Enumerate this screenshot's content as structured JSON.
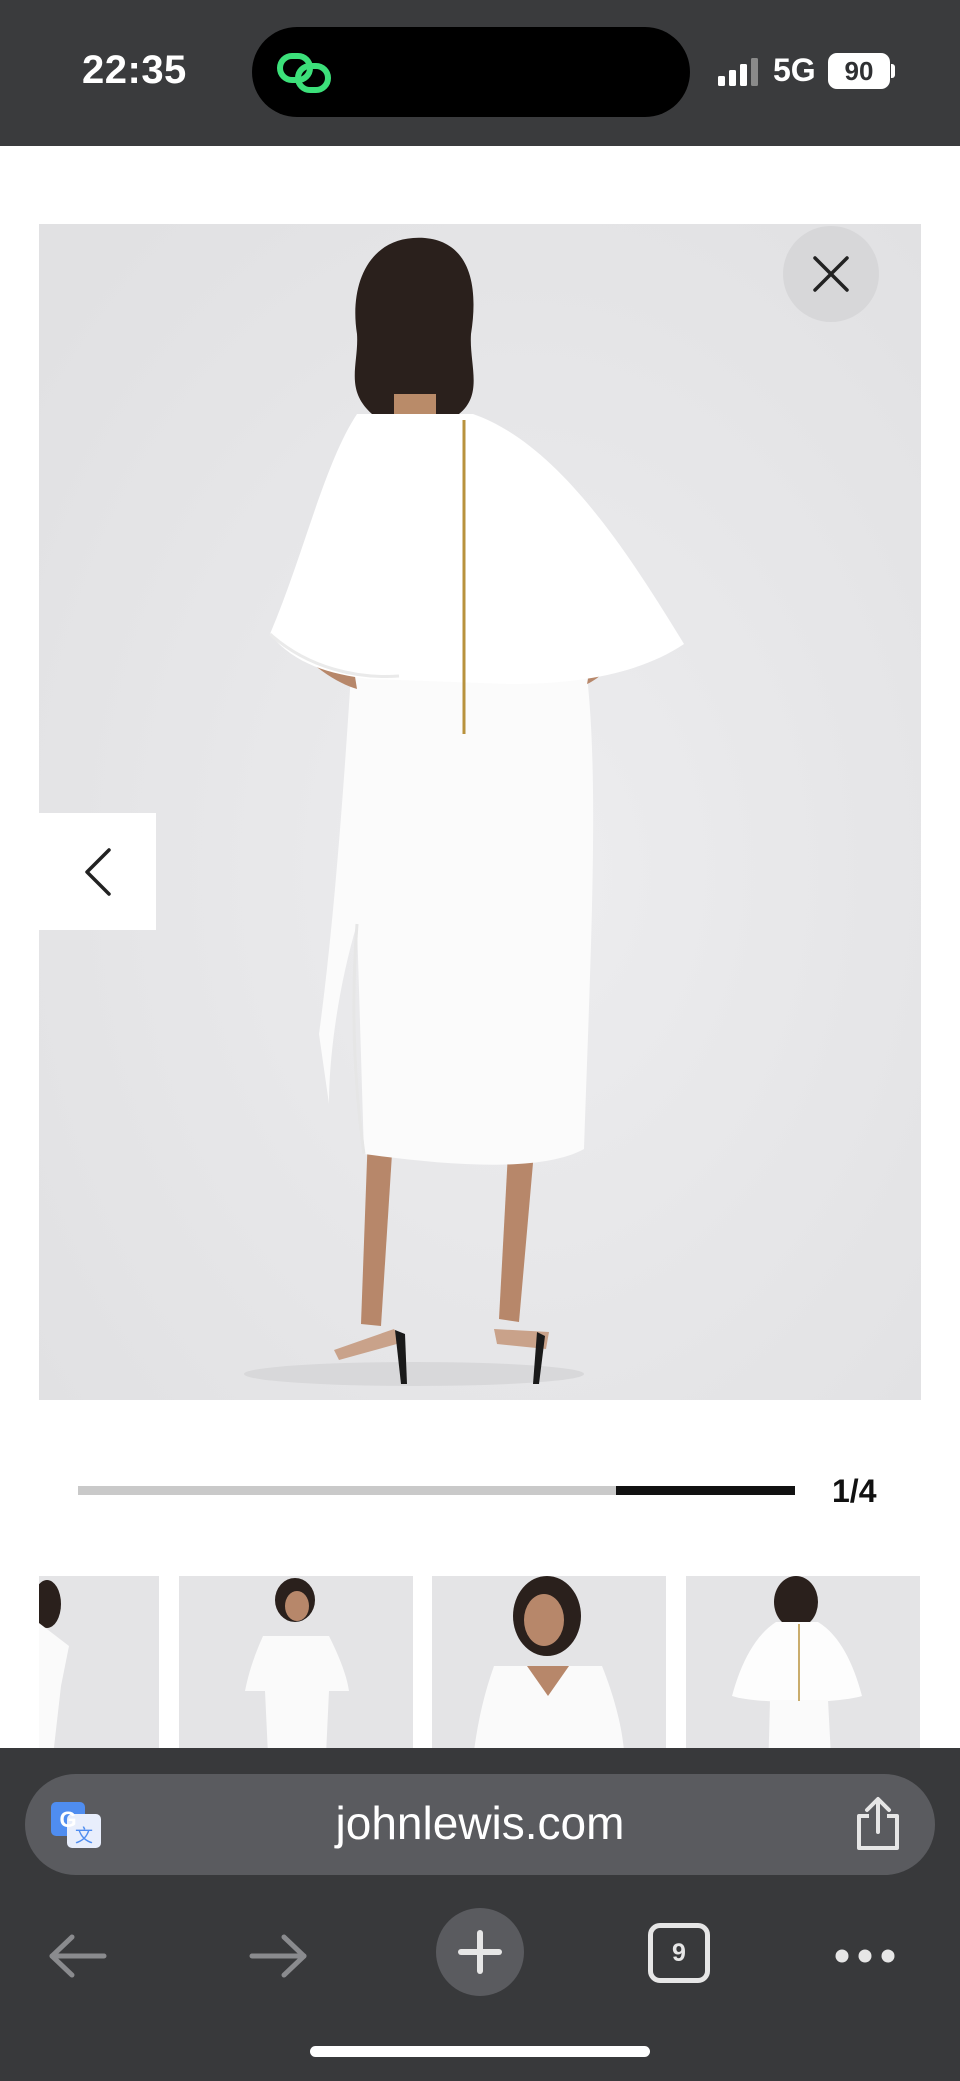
{
  "status_bar": {
    "time": "22:35",
    "network": "5G",
    "battery": "90"
  },
  "viewer": {
    "close_icon": "close-icon",
    "prev_icon": "chevron-left-icon",
    "page_counter": "1/4",
    "progress_fraction": 0.25
  },
  "thumbnails": [
    {
      "view": "side"
    },
    {
      "view": "front"
    },
    {
      "view": "front-close"
    },
    {
      "view": "back"
    }
  ],
  "browser": {
    "url": "johnlewis.com",
    "tab_count": "9",
    "icons": [
      "translate-icon",
      "share-icon",
      "back-arrow-icon",
      "forward-arrow-icon",
      "plus-icon",
      "tabs-icon",
      "more-icon"
    ]
  },
  "colors": {
    "status_bg": "#3a3b3d",
    "browser_bg": "#38393b",
    "pill_bg": "#5a5b5f",
    "accent_green": "#3ce07a"
  }
}
